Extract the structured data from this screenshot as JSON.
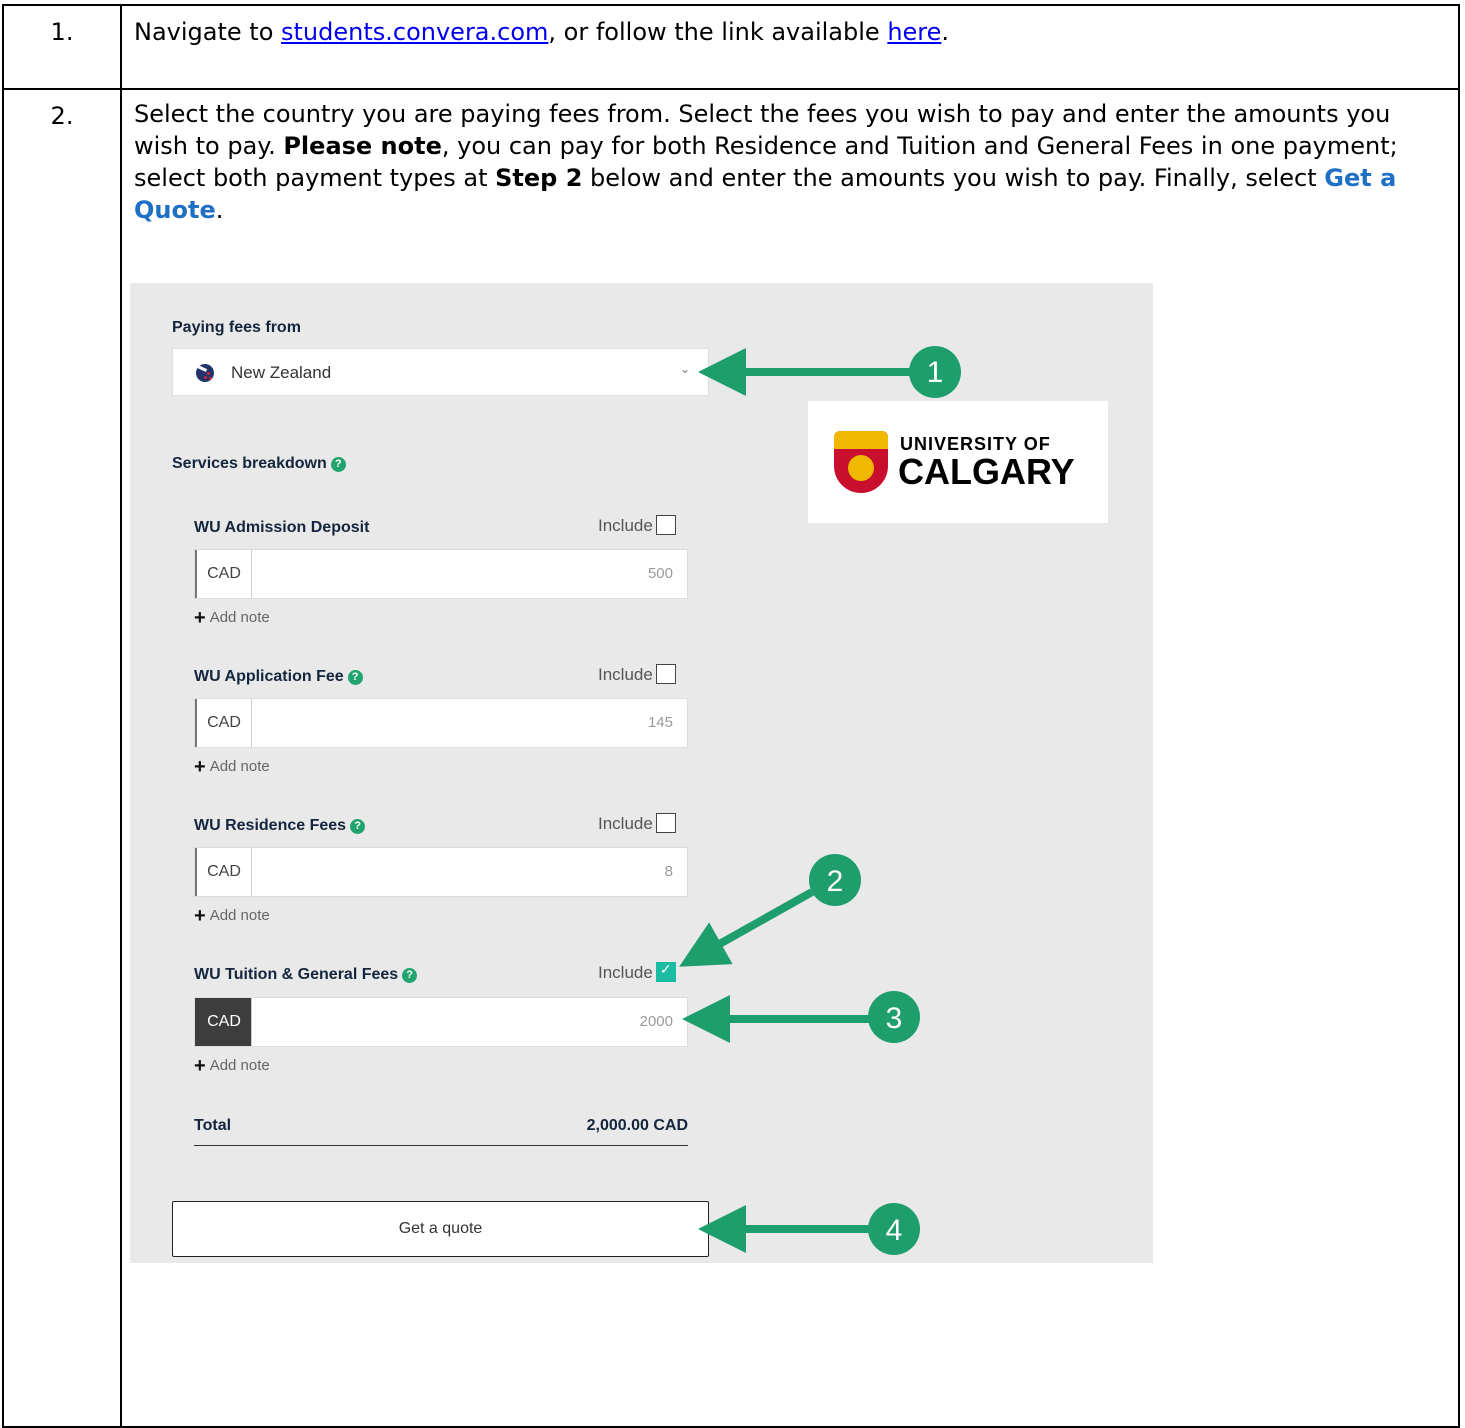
{
  "steps": [
    {
      "number": "1.",
      "text_before": "Navigate to ",
      "link1": "students.convera.com",
      "text_mid": ", or follow the link available ",
      "link2": "here",
      "text_after": "."
    },
    {
      "number": "2.",
      "p1": "Select the country you are paying fees from. Select the fees you wish to pay and enter the amounts you wish to pay. ",
      "p1_bold": "Please note",
      "p2": ", you can pay for both Residence and Tuition and General Fees in one payment; select both payment types at ",
      "p2_bold": "Step 2",
      "p3": " below and enter the amounts you wish to pay. Finally, select ",
      "p3_blue": "Get a Quote",
      "p4": "."
    }
  ],
  "form": {
    "paying_from_label": "Paying fees from",
    "country": "New Zealand",
    "services_label": "Services breakdown",
    "include_label": "Include",
    "add_note": "Add note",
    "fees": [
      {
        "name": "WU Admission Deposit",
        "currency": "CAD",
        "amount": "500",
        "included": false
      },
      {
        "name": "WU Application Fee",
        "currency": "CAD",
        "amount": "145",
        "included": false
      },
      {
        "name": "WU Residence Fees",
        "currency": "CAD",
        "amount": "8",
        "included": false
      },
      {
        "name": "WU Tuition & General Fees",
        "currency": "CAD",
        "amount": "2000",
        "included": true
      }
    ],
    "total_label": "Total",
    "total_value": "2,000.00 CAD",
    "quote_button": "Get a quote"
  },
  "logo": {
    "line1": "UNIVERSITY OF",
    "line2": "CALGARY"
  },
  "callouts": [
    "1",
    "2",
    "3",
    "4"
  ],
  "colors": {
    "callout_green": "#1e9d6d",
    "checkbox_teal": "#1bbca3",
    "help_green": "#22a46f",
    "link_blue": "#0000ee",
    "quote_blue": "#1f6fc4"
  }
}
